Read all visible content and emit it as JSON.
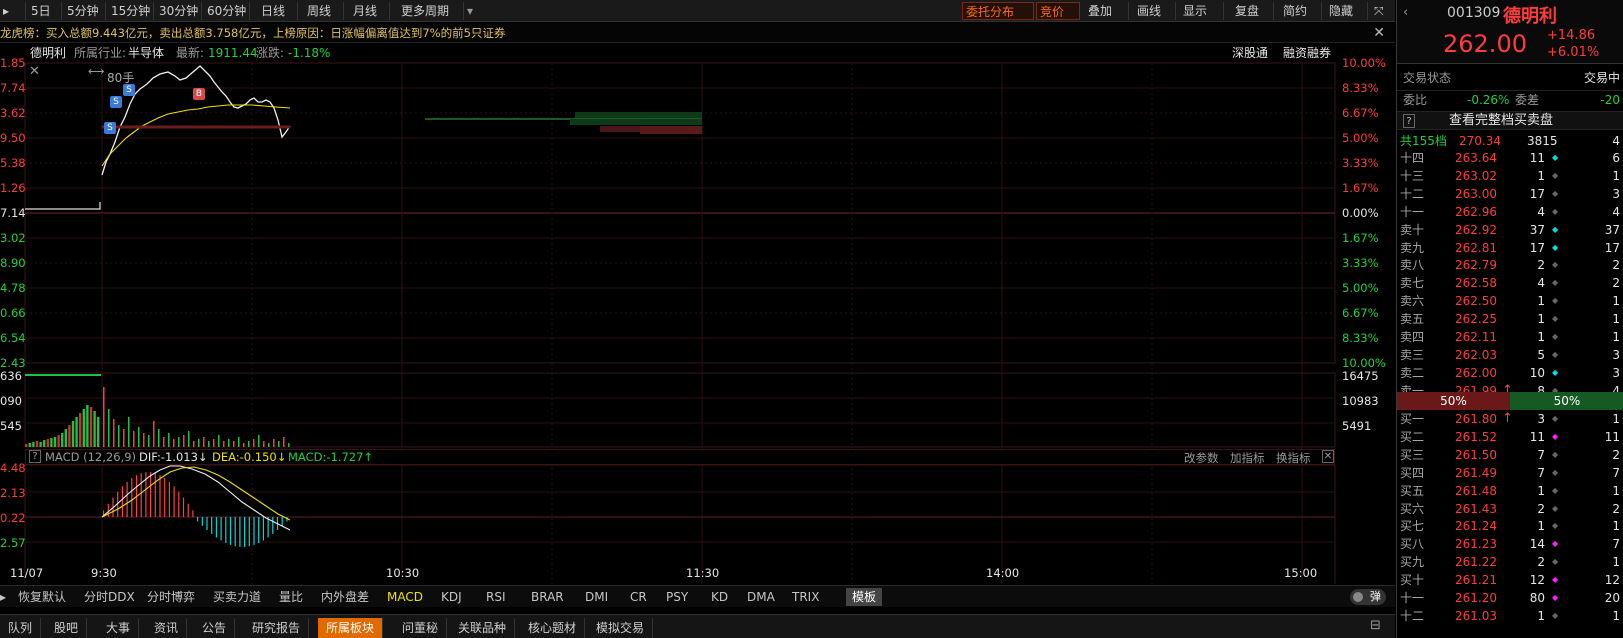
{
  "toolbar": {
    "items": [
      "5日",
      "5分钟",
      "15分钟",
      "30分钟",
      "60分钟",
      "日线",
      "周线",
      "月线",
      "更多周期"
    ],
    "right": [
      "委托分布",
      "竞价",
      "叠加",
      "画线",
      "显示",
      "复盘",
      "简约",
      "隐藏"
    ]
  },
  "headline": "龙虎榜：买入总额9.443亿元，卖出总额3.758亿元，上榜原因：日涨幅偏离值达到7%的前5只证券",
  "info": {
    "name": "德明利",
    "industry_label": "所属行业:",
    "industry": "半导体",
    "latest_label": "最新:",
    "latest": "1911.44",
    "change_label": "涨跌:",
    "change": "-1.18%",
    "link1": "深股通",
    "link2": "融资融券"
  },
  "price_axis": {
    "left": [
      "1.85",
      "7.74",
      "3.62",
      "9.50",
      "5.38",
      "1.26",
      "7.14",
      "3.02",
      "8.90",
      "4.78",
      "0.66",
      "6.54",
      "2.43"
    ],
    "right": [
      "10.00%",
      "8.33%",
      "6.67%",
      "5.00%",
      "3.33%",
      "1.67%",
      "0.00%",
      "1.67%",
      "3.33%",
      "5.00%",
      "6.67%",
      "8.33%",
      "10.00%"
    ]
  },
  "chart_labels": {
    "lot": "80手",
    "marker_s": "S",
    "marker_b": "B"
  },
  "volume_axis": {
    "left": [
      "636",
      "090",
      "545"
    ],
    "right": [
      "16475",
      "10983",
      "5491"
    ]
  },
  "macd": {
    "title": "MACD (12,26,9)",
    "dif": "DIF:-1.013↓",
    "dea": "DEA:-0.150↓",
    "macd": "MACD:-1.727↑",
    "left": [
      "4.48",
      "2.13",
      "0.22",
      "2.57"
    ],
    "actions": [
      "改参数",
      "加指标",
      "换指标"
    ]
  },
  "time_axis": [
    "11/07",
    "9:30",
    "10:30",
    "11:30",
    "14:00",
    "15:00"
  ],
  "indicator_tabs": [
    "恢复默认",
    "分时DDX",
    "分时博弈",
    "买卖力道",
    "量比",
    "内外盘差",
    "MACD",
    "KDJ",
    "RSI",
    "BRAR",
    "DMI",
    "CR",
    "PSY",
    "KD",
    "DMA",
    "TRIX",
    "模板"
  ],
  "indicator_active": "MACD",
  "danmu": "弹",
  "bottom_tabs": [
    "队列",
    "股吧",
    "大事",
    "资讯",
    "公告",
    "研究报告",
    "所属板块",
    "问董秘",
    "关联品种",
    "核心题材",
    "模拟交易"
  ],
  "bottom_active": "所属板块",
  "quote": {
    "code": "001309",
    "name": "德明利",
    "price": "262.00",
    "chg": "+14.86",
    "pct": "+6.01%",
    "status_label": "交易状态",
    "status": "交易中",
    "wb_label": "委比",
    "wb": "-0.26%",
    "wc_label": "委差",
    "wc": "-20",
    "full_btn": "查看完整档买卖盘",
    "q_icon": "?",
    "total_label": "共155档",
    "total_price": "270.34",
    "total_vol": "3815",
    "total_n": "4",
    "split_left": "50%",
    "split_right": "50%"
  },
  "asks": [
    {
      "l": "十四",
      "p": "263.64",
      "v": "11",
      "m": "◆",
      "n": "6",
      "mc": "cyan"
    },
    {
      "l": "十三",
      "p": "263.02",
      "v": "1",
      "m": "◆",
      "n": "1",
      "mc": "grey"
    },
    {
      "l": "十二",
      "p": "263.00",
      "v": "17",
      "m": "◆",
      "n": "3",
      "mc": "grey"
    },
    {
      "l": "十一",
      "p": "262.96",
      "v": "4",
      "m": "◆",
      "n": "4",
      "mc": "grey"
    },
    {
      "l": "卖十",
      "p": "262.92",
      "v": "37",
      "m": "◆",
      "n": "37",
      "mc": "cyan"
    },
    {
      "l": "卖九",
      "p": "262.81",
      "v": "17",
      "m": "◆",
      "n": "17",
      "mc": "cyan"
    },
    {
      "l": "卖八",
      "p": "262.79",
      "v": "2",
      "m": "◆",
      "n": "2",
      "mc": "grey"
    },
    {
      "l": "卖七",
      "p": "262.58",
      "v": "4",
      "m": "◆",
      "n": "2",
      "mc": "grey"
    },
    {
      "l": "卖六",
      "p": "262.50",
      "v": "1",
      "m": "◆",
      "n": "1",
      "mc": "grey"
    },
    {
      "l": "卖五",
      "p": "262.25",
      "v": "1",
      "m": "◆",
      "n": "1",
      "mc": "grey"
    },
    {
      "l": "卖四",
      "p": "262.11",
      "v": "1",
      "m": "◆",
      "n": "1",
      "mc": "grey"
    },
    {
      "l": "卖三",
      "p": "262.03",
      "v": "5",
      "m": "◆",
      "n": "3",
      "mc": "grey"
    },
    {
      "l": "卖二",
      "p": "262.00",
      "v": "10",
      "m": "◆",
      "n": "3",
      "mc": "cyan"
    },
    {
      "l": "卖一",
      "p": "261.99",
      "v": "8",
      "m": "◆",
      "n": "4",
      "mc": "grey",
      "arrow": "↑"
    }
  ],
  "bids": [
    {
      "l": "买一",
      "p": "261.80",
      "v": "3",
      "m": "◆",
      "n": "1",
      "mc": "grey",
      "arrow": "↑"
    },
    {
      "l": "买二",
      "p": "261.52",
      "v": "11",
      "m": "◆",
      "n": "11",
      "mc": "mag"
    },
    {
      "l": "买三",
      "p": "261.50",
      "v": "7",
      "m": "◆",
      "n": "2",
      "mc": "grey"
    },
    {
      "l": "买四",
      "p": "261.49",
      "v": "7",
      "m": "◆",
      "n": "7",
      "mc": "grey"
    },
    {
      "l": "买五",
      "p": "261.48",
      "v": "1",
      "m": "◆",
      "n": "1",
      "mc": "grey"
    },
    {
      "l": "买六",
      "p": "261.43",
      "v": "2",
      "m": "◆",
      "n": "2",
      "mc": "grey"
    },
    {
      "l": "买七",
      "p": "261.24",
      "v": "1",
      "m": "◆",
      "n": "1",
      "mc": "grey"
    },
    {
      "l": "买八",
      "p": "261.23",
      "v": "14",
      "m": "◆",
      "n": "7",
      "mc": "mag"
    },
    {
      "l": "买九",
      "p": "261.22",
      "v": "2",
      "m": "◆",
      "n": "1",
      "mc": "grey"
    },
    {
      "l": "买十",
      "p": "261.21",
      "v": "12",
      "m": "◆",
      "n": "12",
      "mc": "mag"
    },
    {
      "l": "十一",
      "p": "261.20",
      "v": "80",
      "m": "◆",
      "n": "20",
      "mc": "mag"
    },
    {
      "l": "十二",
      "p": "261.03",
      "v": "1",
      "m": "◆",
      "n": "1",
      "mc": "grey"
    }
  ]
}
